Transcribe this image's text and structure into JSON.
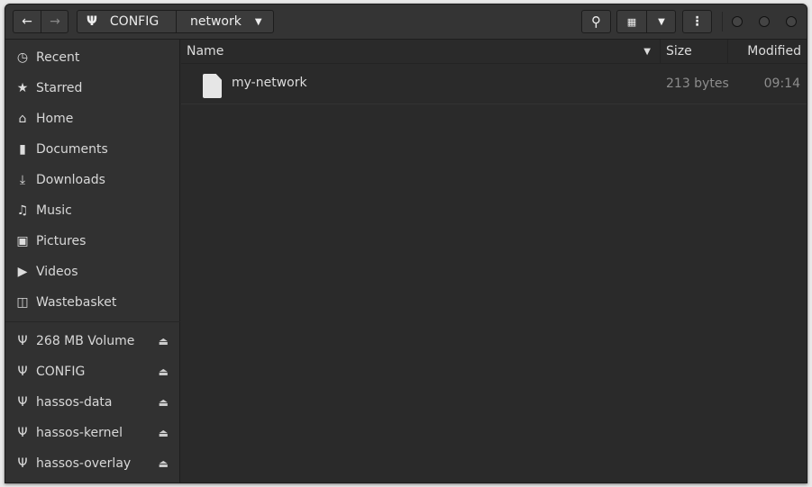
{
  "headerbar": {
    "back_icon": "arrow-left-icon",
    "forward_icon": "arrow-right-icon",
    "path": [
      {
        "label": "CONFIG",
        "icon": "usb-icon"
      },
      {
        "label": "network"
      }
    ],
    "search_icon": "search-icon",
    "view_icon": "grid-icon",
    "menu_icon": "kebab-menu-icon"
  },
  "sidebar": {
    "places": [
      {
        "label": "Recent",
        "icon": "clock-icon"
      },
      {
        "label": "Starred",
        "icon": "star-icon"
      },
      {
        "label": "Home",
        "icon": "home-icon"
      },
      {
        "label": "Documents",
        "icon": "document-icon"
      },
      {
        "label": "Downloads",
        "icon": "download-icon"
      },
      {
        "label": "Music",
        "icon": "music-icon"
      },
      {
        "label": "Pictures",
        "icon": "picture-icon"
      },
      {
        "label": "Videos",
        "icon": "video-icon"
      },
      {
        "label": "Wastebasket",
        "icon": "trash-icon"
      }
    ],
    "devices": [
      {
        "label": "268 MB Volume"
      },
      {
        "label": "CONFIG"
      },
      {
        "label": "hassos-data"
      },
      {
        "label": "hassos-kernel"
      },
      {
        "label": "hassos-overlay"
      }
    ]
  },
  "columns": {
    "name": "Name",
    "size": "Size",
    "modified": "Modified"
  },
  "files": [
    {
      "name": "my-network",
      "size": "213 bytes",
      "modified": "09:14"
    }
  ]
}
